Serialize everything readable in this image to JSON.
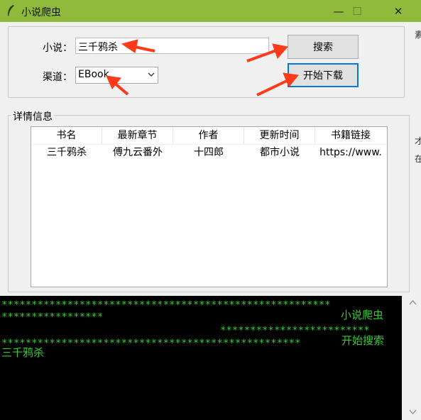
{
  "window": {
    "title": "小说爬虫",
    "controls": {
      "minimize": "—",
      "maximize": "☐",
      "close": "✕"
    }
  },
  "search": {
    "novel_label": "小说：",
    "novel_value": "三千鸦杀",
    "channel_label": "渠道：",
    "channel_value": "EBook",
    "search_button": "搜索",
    "download_button": "开始下载"
  },
  "details": {
    "group_label": "详情信息",
    "columns": [
      "书名",
      "最新章节",
      "作者",
      "更新时间",
      "书籍链接"
    ],
    "rows": [
      [
        "三千鸦杀",
        "傅九云番外",
        "十四郎",
        "都市小说",
        "https://www."
      ]
    ]
  },
  "console": {
    "lines": [
      "*******************************************************",
      "*****************",
      "小说爬虫",
      "*************************",
      "**************************************************",
      "开始搜索",
      "三千鸦杀"
    ]
  },
  "colors": {
    "titlebar": "#8fba3c",
    "console_bg": "#000000",
    "console_fg": "#33cc33",
    "arrow": "#ff3a1a"
  }
}
